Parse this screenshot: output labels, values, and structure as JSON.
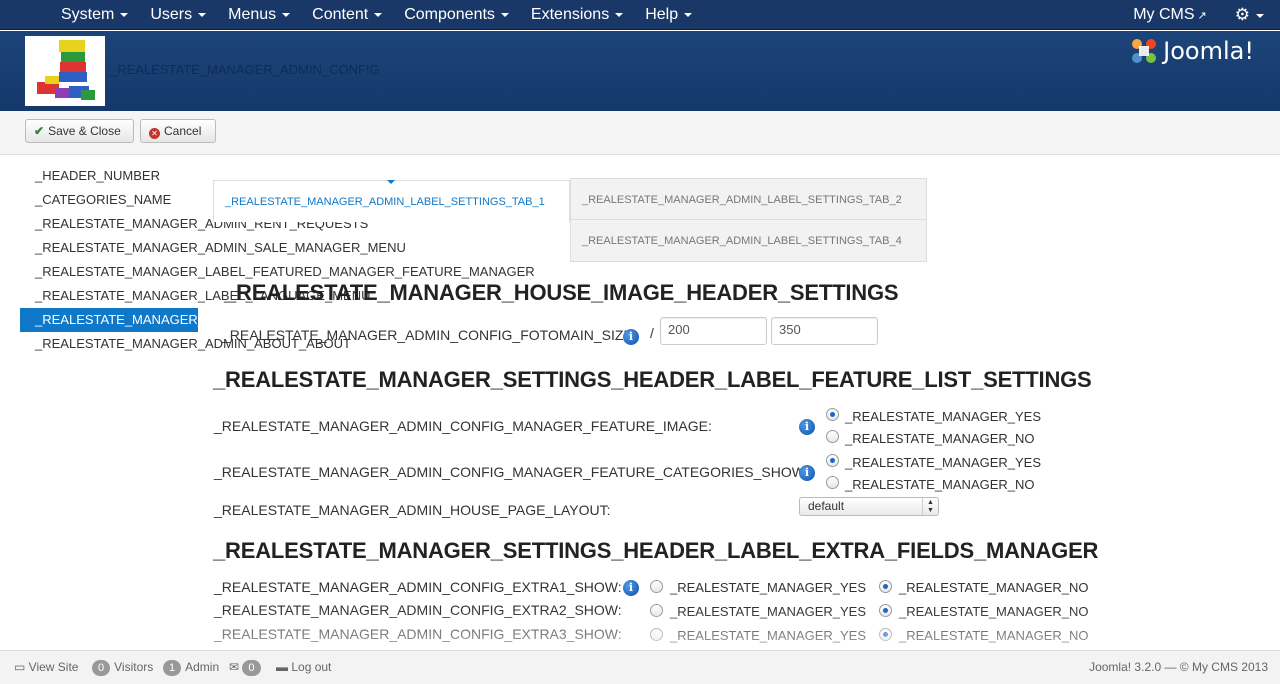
{
  "topnav": {
    "menu": [
      "System",
      "Users",
      "Menus",
      "Content",
      "Components",
      "Extensions",
      "Help"
    ],
    "site_link": "My CMS"
  },
  "header": {
    "title": "_REALESTATE_MANAGER_ADMIN_CONFIG",
    "brand": "Joomla!"
  },
  "toolbar": {
    "save_close": "Save & Close",
    "cancel": "Cancel"
  },
  "sidebar": {
    "items": [
      "_HEADER_NUMBER",
      "_CATEGORIES_NAME",
      "_REALESTATE_MANAGER_ADMIN_RENT_REQUESTS",
      "_REALESTATE_MANAGER_ADMIN_SALE_MANAGER_MENU",
      "_REALESTATE_MANAGER_LABEL_FEATURED_MANAGER_FEATURE_MANAGER",
      "_REALESTATE_MANAGER_LABEL_LANGUAGE_MENU",
      "_REALESTATE_MANAGER_ADMIN_LABEL_SETTINGS",
      "_REALESTATE_MANAGER_ADMIN_ABOUT_ABOUT"
    ],
    "active_index": 6
  },
  "tabs": {
    "tab1": "_REALESTATE_MANAGER_ADMIN_LABEL_SETTINGS_TAB_1",
    "tab2": "_REALESTATE_MANAGER_ADMIN_LABEL_SETTINGS_TAB_2",
    "tab4": "_REALESTATE_MANAGER_ADMIN_LABEL_SETTINGS_TAB_4"
  },
  "content": {
    "image_header": "_REALESTATE_MANAGER_HOUSE_IMAGE_HEADER_SETTINGS",
    "fotomain_label": "_REALESTATE_MANAGER_ADMIN_CONFIG_FOTOMAIN_SIZE:",
    "fotomain_sep": "/",
    "fotomain_width": "200",
    "fotomain_height": "350",
    "feature_header": "_REALESTATE_MANAGER_SETTINGS_HEADER_LABEL_FEATURE_LIST_SETTINGS",
    "feature_image_label": "_REALESTATE_MANAGER_ADMIN_CONFIG_MANAGER_FEATURE_IMAGE:",
    "feature_categories_label": "_REALESTATE_MANAGER_ADMIN_CONFIG_MANAGER_FEATURE_CATEGORIES_SHOW:",
    "house_layout_label": "_REALESTATE_MANAGER_ADMIN_HOUSE_PAGE_LAYOUT:",
    "house_layout_value": "default",
    "extra_header": "_REALESTATE_MANAGER_SETTINGS_HEADER_LABEL_EXTRA_FIELDS_MANAGER",
    "extra1_label": "_REALESTATE_MANAGER_ADMIN_CONFIG_EXTRA1_SHOW:",
    "extra2_label": "_REALESTATE_MANAGER_ADMIN_CONFIG_EXTRA2_SHOW:",
    "extra3_label": "_REALESTATE_MANAGER_ADMIN_CONFIG_EXTRA3_SHOW:",
    "yes": "_REALESTATE_MANAGER_YES",
    "no": "_REALESTATE_MANAGER_NO"
  },
  "statusbar": {
    "view_site": "View Site",
    "visitors_count": "0",
    "visitors": "Visitors",
    "admin_count": "1",
    "admin": "Admin",
    "messages_count": "0",
    "logout": "Log out",
    "copyright": "Joomla! 3.2.0  —  © My CMS 2013"
  }
}
